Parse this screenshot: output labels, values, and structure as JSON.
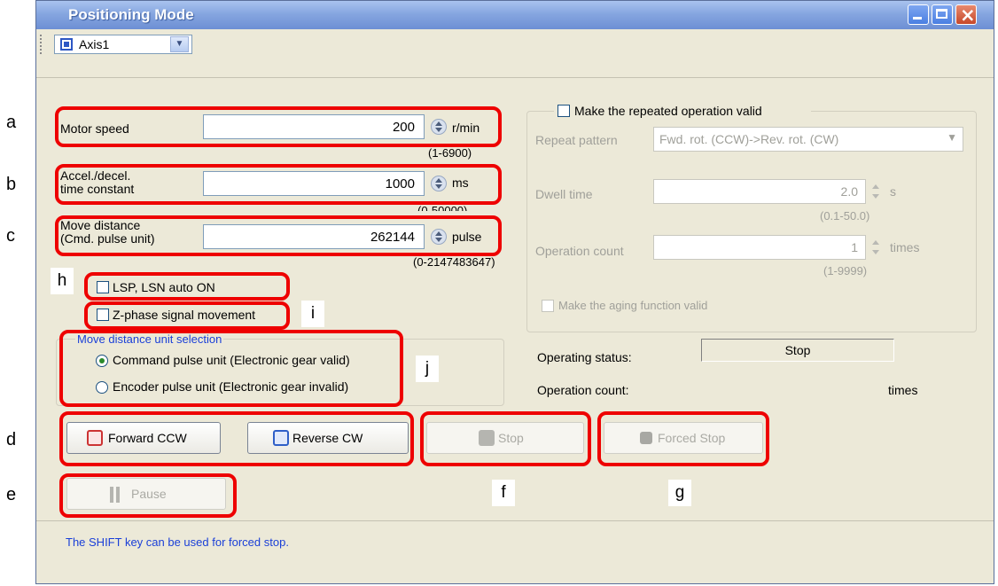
{
  "window": {
    "title": "Positioning Mode"
  },
  "toolbar": {
    "axis_value": "Axis1"
  },
  "fields": {
    "motor_speed": {
      "label": "Motor speed",
      "value": "200",
      "unit": "r/min",
      "range": "(1-6900)"
    },
    "accel": {
      "label_line1": "Accel./decel.",
      "label_line2": "time constant",
      "value": "1000",
      "unit": "ms",
      "range": "(0-50000)"
    },
    "move_distance": {
      "label_line1": "Move distance",
      "label_line2": "(Cmd. pulse unit)",
      "value": "262144",
      "unit": "pulse",
      "range": "(0-2147483647)"
    }
  },
  "checkboxes": {
    "lsp_lsn": "LSP, LSN auto ON",
    "z_phase": "Z-phase signal movement"
  },
  "unit_selection": {
    "title": "Move distance unit selection",
    "option1": "Command pulse unit (Electronic gear valid)",
    "option2": "Encoder pulse unit (Electronic gear invalid)"
  },
  "repeat": {
    "checkbox_label": "Make the repeated operation valid",
    "pattern_label": "Repeat pattern",
    "pattern_value": "Fwd. rot. (CCW)->Rev. rot. (CW)",
    "dwell_label": "Dwell time",
    "dwell_value": "2.0",
    "dwell_unit": "s",
    "dwell_range": "(0.1-50.0)",
    "count_label": "Operation count",
    "count_value": "1",
    "count_unit": "times",
    "count_range": "(1-9999)",
    "aging_label": "Make the aging function valid"
  },
  "status": {
    "operating_label": "Operating status:",
    "operating_value": "Stop",
    "count_label": "Operation count:",
    "count_unit": "times"
  },
  "buttons": {
    "forward": "Forward CCW",
    "reverse": "Reverse CW",
    "stop": "Stop",
    "forced_stop": "Forced Stop",
    "pause": "Pause"
  },
  "footer": {
    "message": "The SHIFT key can be used for forced stop."
  },
  "annotations": {
    "a": "a",
    "b": "b",
    "c": "c",
    "d": "d",
    "e": "e",
    "f": "f",
    "g": "g",
    "h": "h",
    "i": "i",
    "j": "j"
  },
  "colors": {
    "highlight": "#ee0000",
    "footer_text": "#1a3fd8",
    "group_title": "#1a3fd8"
  }
}
